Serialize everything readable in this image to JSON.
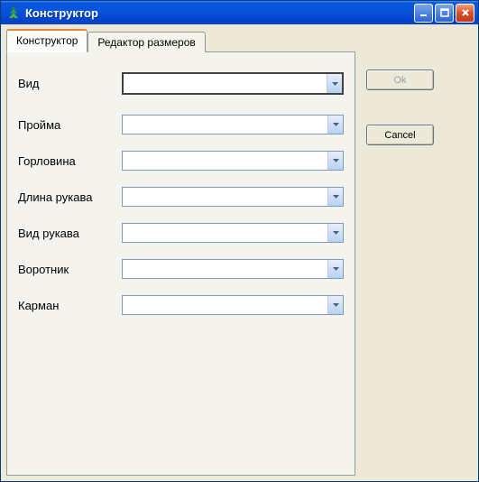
{
  "window": {
    "title": "Конструктор"
  },
  "tabs": [
    {
      "label": "Конструктор",
      "active": true
    },
    {
      "label": "Редактор размеров",
      "active": false
    }
  ],
  "fields": [
    {
      "label": "Вид",
      "value": ""
    },
    {
      "label": "Пройма",
      "value": ""
    },
    {
      "label": "Горловина",
      "value": ""
    },
    {
      "label": "Длина рукава",
      "value": ""
    },
    {
      "label": "Вид рукава",
      "value": ""
    },
    {
      "label": "Воротник",
      "value": ""
    },
    {
      "label": "Карман",
      "value": ""
    }
  ],
  "buttons": {
    "ok": "Ok",
    "cancel": "Cancel"
  }
}
